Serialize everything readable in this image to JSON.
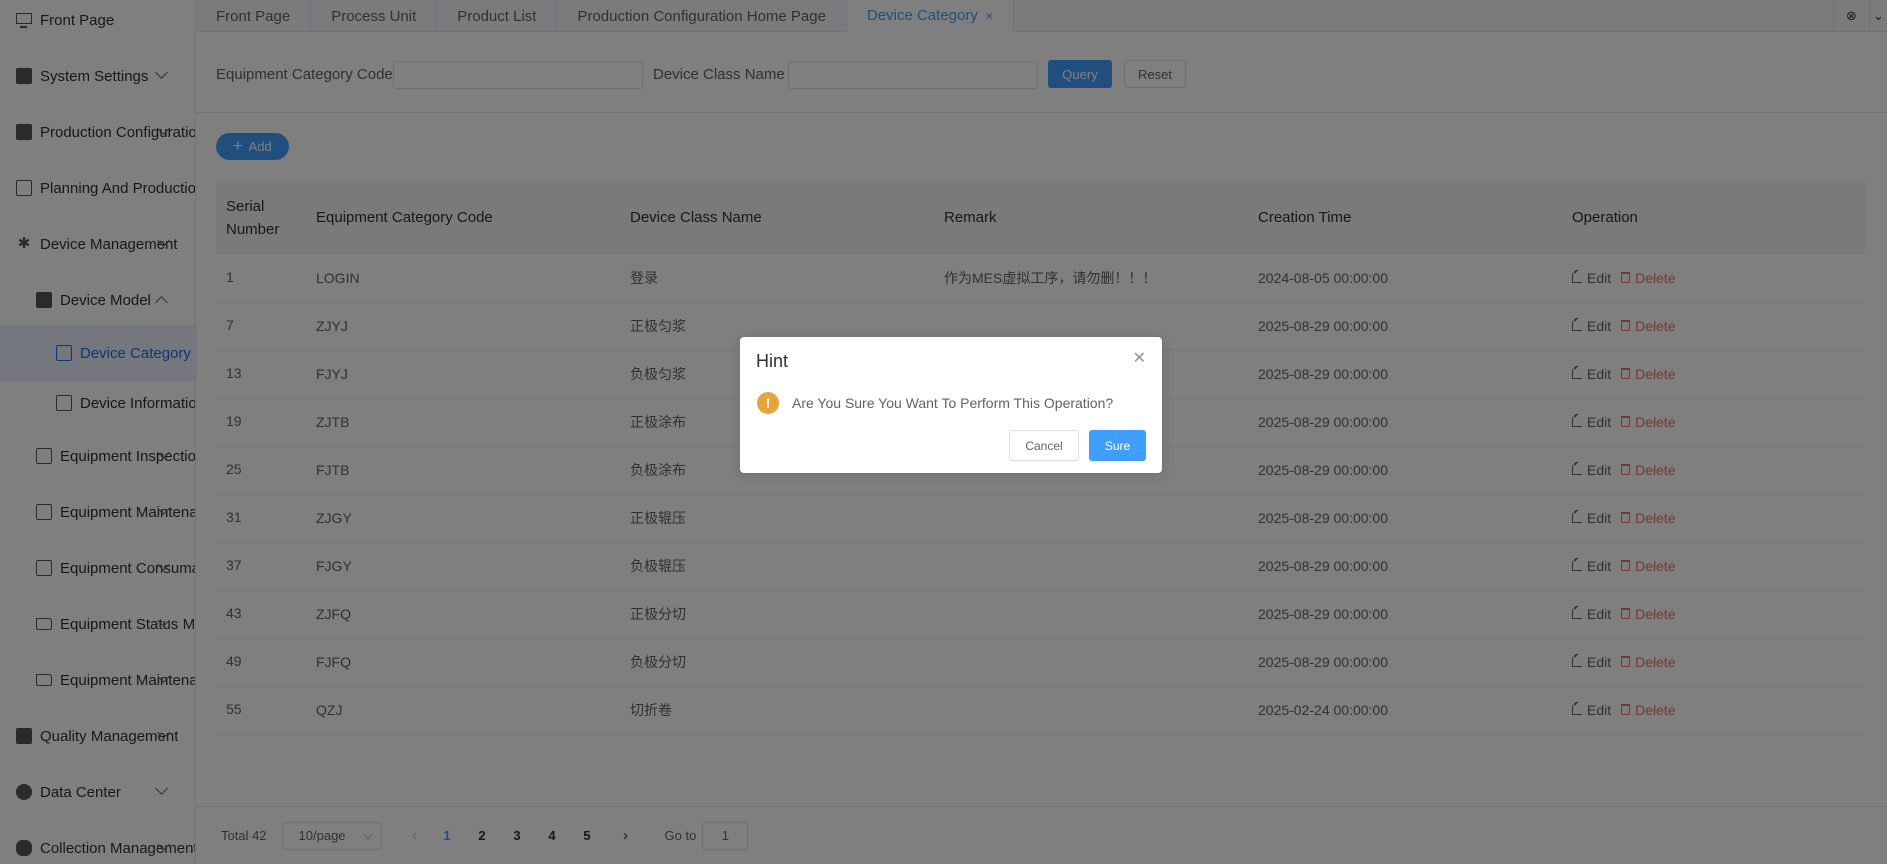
{
  "sidebar": {
    "items": [
      {
        "label": "Front Page",
        "icon": "monitor-icon"
      },
      {
        "label": "System Settings",
        "icon": "settings-icon"
      },
      {
        "label": "Production Configuration",
        "icon": "briefcase-icon"
      },
      {
        "label": "Planning And Production",
        "icon": "windows-icon"
      },
      {
        "label": "Device Management",
        "icon": "gear-star-icon"
      },
      {
        "label": "Device Model",
        "icon": "bars-icon"
      },
      {
        "label": "Device Category",
        "icon": "category-icon"
      },
      {
        "label": "Device Information",
        "icon": "printer-icon"
      },
      {
        "label": "Equipment Inspection",
        "icon": "inspection-icon"
      },
      {
        "label": "Equipment Maintenance",
        "icon": "maintenance-icon"
      },
      {
        "label": "Equipment Consumables",
        "icon": "list-icon"
      },
      {
        "label": "Equipment Status Management",
        "icon": "folder-icon"
      },
      {
        "label": "Equipment Maintenance Records",
        "icon": "folder-icon"
      },
      {
        "label": "Quality Management",
        "icon": "briefcase-icon"
      },
      {
        "label": "Data Center",
        "icon": "pie-icon"
      },
      {
        "label": "Collection Management",
        "icon": "database-icon"
      }
    ]
  },
  "tabs": [
    {
      "label": "Front Page"
    },
    {
      "label": "Process Unit"
    },
    {
      "label": "Product List"
    },
    {
      "label": "Production Configuration Home Page"
    },
    {
      "label": "Device Category",
      "close": "×"
    }
  ],
  "search": {
    "code_label": "Equipment Category Code",
    "name_label": "Device Class Name",
    "query": "Query",
    "reset": "Reset"
  },
  "add_label": "Add",
  "table": {
    "headers": [
      "Serial Number",
      "Equipment Category Code",
      "Device Class Name",
      "Remark",
      "Creation Time",
      "Operation"
    ],
    "edit_label": "Edit",
    "delete_label": "Delete",
    "rows": [
      {
        "no": "1",
        "code": "LOGIN",
        "name": "登录",
        "remark": "作为MES虚拟工序，请勿删！！！",
        "time": "2024-08-05 00:00:00"
      },
      {
        "no": "7",
        "code": "ZJYJ",
        "name": "正极匀浆",
        "remark": "",
        "time": "2025-08-29 00:00:00"
      },
      {
        "no": "13",
        "code": "FJYJ",
        "name": "负极匀浆",
        "remark": "",
        "time": "2025-08-29 00:00:00"
      },
      {
        "no": "19",
        "code": "ZJTB",
        "name": "正极涂布",
        "remark": "",
        "time": "2025-08-29 00:00:00"
      },
      {
        "no": "25",
        "code": "FJTB",
        "name": "负极涂布",
        "remark": "",
        "time": "2025-08-29 00:00:00"
      },
      {
        "no": "31",
        "code": "ZJGY",
        "name": "正极辊压",
        "remark": "",
        "time": "2025-08-29 00:00:00"
      },
      {
        "no": "37",
        "code": "FJGY",
        "name": "负极辊压",
        "remark": "",
        "time": "2025-08-29 00:00:00"
      },
      {
        "no": "43",
        "code": "ZJFQ",
        "name": "正极分切",
        "remark": "",
        "time": "2025-08-29 00:00:00"
      },
      {
        "no": "49",
        "code": "FJFQ",
        "name": "负极分切",
        "remark": "",
        "time": "2025-08-29 00:00:00"
      },
      {
        "no": "55",
        "code": "QZJ",
        "name": "切折卷",
        "remark": "",
        "time": "2025-02-24 00:00:00"
      }
    ]
  },
  "pagination": {
    "total": "Total 42",
    "page_size": "10/page",
    "pages": [
      "1",
      "2",
      "3",
      "4",
      "5"
    ],
    "current": "1",
    "goto_label": "Go to",
    "goto_value": "1"
  },
  "dialog": {
    "title": "Hint",
    "message": "Are You Sure You Want To Perform This Operation?",
    "cancel": "Cancel",
    "confirm": "Sure"
  },
  "colors": {
    "primary": "#409eff",
    "danger": "#f56c6c",
    "warning": "#e6a23c"
  }
}
